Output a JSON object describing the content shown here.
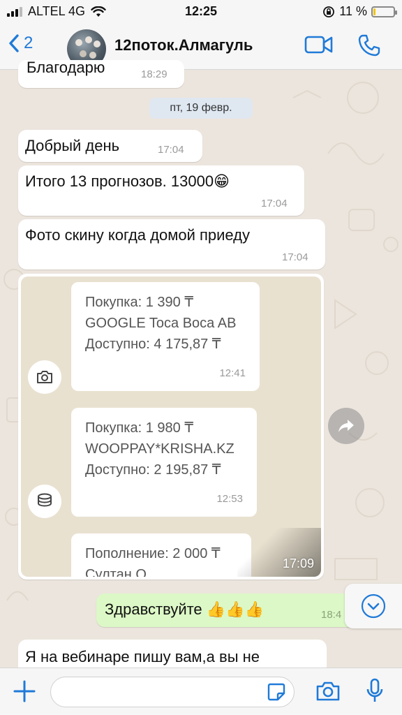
{
  "status_bar": {
    "carrier": "ALTEL 4G",
    "time": "12:25",
    "battery_percent": "11 %",
    "battery_level": 0.11
  },
  "header": {
    "back_count": "2",
    "title": "12поток.Алмагуль"
  },
  "messages": {
    "partial_top": {
      "text": "Благодарю",
      "time": "18:29"
    },
    "date_separator": "пт, 19 февр.",
    "m1": {
      "text": "Добрый день",
      "time": "17:04"
    },
    "m2": {
      "text": "Итого 13 прогнозов. 13000😁",
      "time": "17:04"
    },
    "m3": {
      "text": "Фото скину когда домой приеду",
      "time": "17:04"
    },
    "image_message": {
      "time": "17:09",
      "cards": [
        {
          "line1": "Покупка: 1 390 ₸",
          "line2": "GOOGLE Toca Boca AB",
          "line3": "Доступно: 4 175,87 ₸",
          "time": "12:41"
        },
        {
          "line1": "Покупка: 1 980 ₸",
          "line2": "WOOPPAY*KRISHA.KZ",
          "line3": "Доступно: 2 195,87 ₸",
          "time": "12:53"
        },
        {
          "line1": "Пополнение: 2 000 ₸",
          "line2": "Султан О."
        }
      ]
    },
    "outgoing": {
      "text": "Здравствуйте 👍👍👍",
      "time": "18:4"
    },
    "last": {
      "text": "Я на вебинаре пишу вам,а вы не"
    }
  },
  "icons": {
    "back": "chevron-left-icon",
    "video": "video-camera-icon",
    "call": "phone-icon",
    "forward": "forward-arrow-icon",
    "scroll": "chevron-down-icon",
    "plus": "plus-icon",
    "sticker": "sticker-icon",
    "camera": "camera-icon",
    "mic": "microphone-icon"
  },
  "colors": {
    "accent": "#1f7ad8",
    "outgoing_bubble": "#dcf8c6",
    "chat_bg": "#ece5dd",
    "battery": "#f0c400"
  }
}
